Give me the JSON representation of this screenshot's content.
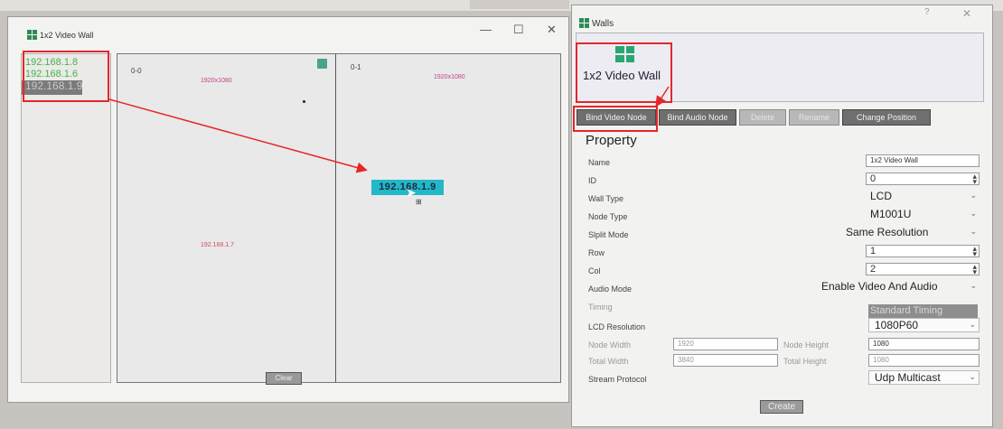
{
  "left_window": {
    "title": "1x2 Video Wall",
    "controls": {
      "minimize": "—",
      "maximize": "☐",
      "close": "✕"
    },
    "ip_list": [
      {
        "label": "192.168.1.8",
        "state": "green"
      },
      {
        "label": "192.168.1.6",
        "state": "green"
      },
      {
        "label": "192.168.1.9",
        "state": "selected"
      }
    ],
    "cells": [
      {
        "id": "0-0",
        "resolution": "1920x1080",
        "node_ip": "192.168.1.7"
      },
      {
        "id": "0-1",
        "resolution": "1920x1080",
        "dropped_node": "192.168.1.9"
      }
    ],
    "clear_label": "Clear"
  },
  "right_window": {
    "title": "Walls",
    "controls": {
      "help": "?",
      "close": "✕"
    },
    "wall_name": "1x2 Video Wall",
    "toolbar": {
      "bind_video": "Bind Video Node",
      "bind_audio": "Bind Audio Node",
      "delete": "Delete",
      "rename": "Rename",
      "change_position": "Change Position"
    },
    "property_title": "Property",
    "properties": {
      "name_label": "Name",
      "name_value": "1x2 Video Wall",
      "id_label": "ID",
      "id_value": "0",
      "wall_type_label": "Wall Type",
      "wall_type_value": "LCD",
      "node_type_label": "Node Type",
      "node_type_value": "M1001U",
      "split_mode_label": "Slplit Mode",
      "split_mode_value": "Same Resolution",
      "row_label": "Row",
      "row_value": "1",
      "col_label": "Col",
      "col_value": "2",
      "audio_mode_label": "Audio Mode",
      "audio_mode_value": "Enable Video And Audio",
      "timing_label": "Timing",
      "timing_value": "Standard Timing",
      "lcd_res_label": "LCD Resolution",
      "lcd_res_value": "1080P60",
      "node_width_label": "Node Width",
      "node_width_value": "1920",
      "node_height_label": "Node Height",
      "node_height_value": "1080",
      "total_width_label": "Total Width",
      "total_width_value": "3840",
      "total_height_label": "Total Height",
      "total_height_value": "1080",
      "stream_protocol_label": "Stream Protocol",
      "stream_protocol_value": "Udp Multicast"
    },
    "create_label": "Create"
  },
  "icons": {
    "chevron": "⌄",
    "spinner": "▲▼",
    "cursor": "➜"
  },
  "colors": {
    "annotation": "#e6262a",
    "online_ip": "#3cb64a",
    "drop_box": "#22b8c8",
    "wall_icon": "#2aa574"
  }
}
